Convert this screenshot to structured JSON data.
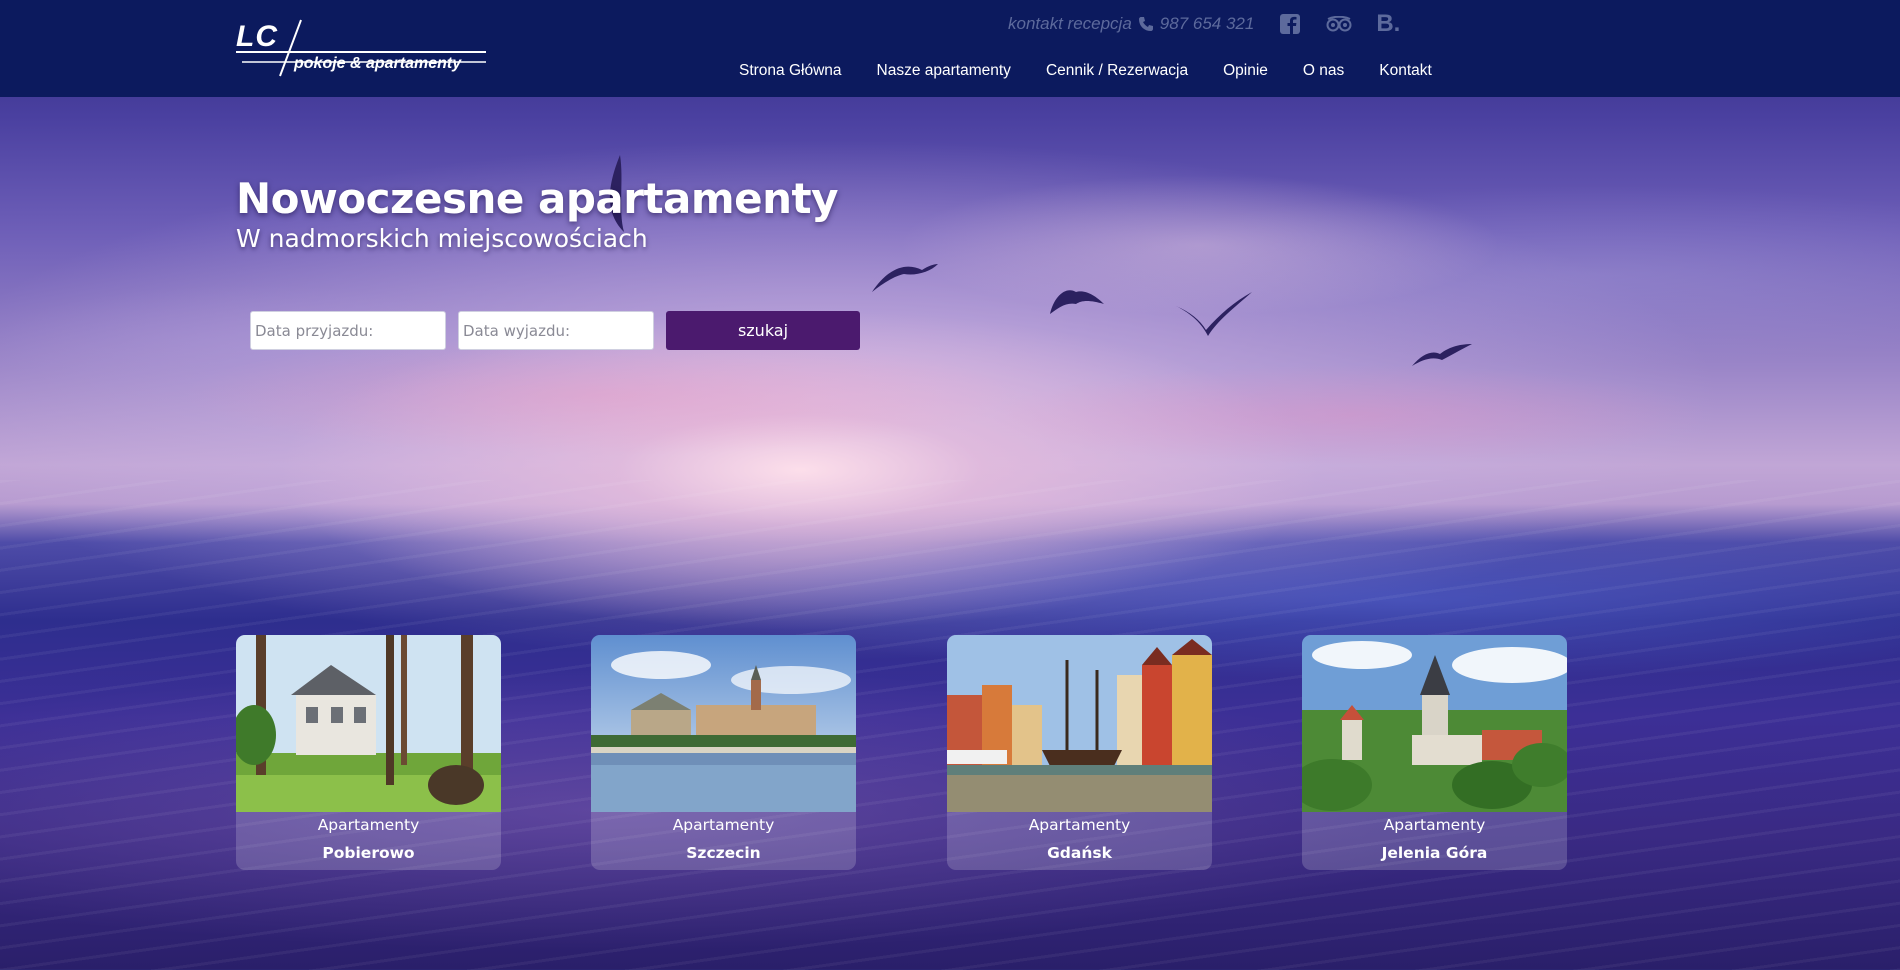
{
  "logo": {
    "mark": "LC",
    "subtitle": "pokoje & apartamenty"
  },
  "topbar": {
    "contact_label": "kontakt recepcja",
    "phone": "987 654 321",
    "icons": [
      "phone-icon",
      "facebook-icon",
      "tripadvisor-icon",
      "booking-icon"
    ],
    "booking_glyph": "B."
  },
  "nav": {
    "items": [
      {
        "label": "Strona Główna"
      },
      {
        "label": "Nasze apartamenty"
      },
      {
        "label": "Cennik / Rezerwacja"
      },
      {
        "label": "Opinie"
      },
      {
        "label": "O nas"
      },
      {
        "label": "Kontakt"
      }
    ]
  },
  "hero": {
    "title": "Nowoczesne apartamenty",
    "subtitle": "W nadmorskich miejscowościach"
  },
  "search": {
    "arrival_placeholder": "Data przyjazdu:",
    "departure_placeholder": "Data wyjazdu:",
    "button_label": "szukaj"
  },
  "cards": [
    {
      "kicker": "Apartamenty",
      "city": "Pobierowo"
    },
    {
      "kicker": "Apartamenty",
      "city": "Szczecin"
    },
    {
      "kicker": "Apartamenty",
      "city": "Gdańsk"
    },
    {
      "kicker": "Apartamenty",
      "city": "Jelenia Góra"
    }
  ],
  "colors": {
    "header_bg": "#0c1a5e",
    "muted_text": "#5d6a9c",
    "button_bg": "#4b1a6e",
    "card_overlay": "rgba(255,255,255,0.18)"
  }
}
